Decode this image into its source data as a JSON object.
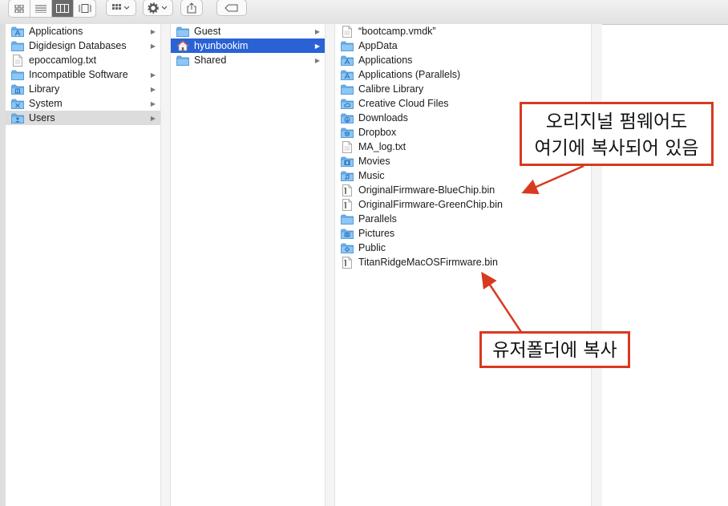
{
  "toolbar": {
    "view_buttons": [
      "icon-view",
      "list-view",
      "column-view",
      "cover-flow-view"
    ],
    "active_view": "column-view",
    "arrange_icon": "grid-arrange-icon",
    "action_icon": "gear-icon",
    "share_icon": "share-icon",
    "tag_icon": "tag-icon"
  },
  "columns": [
    {
      "items": [
        {
          "label": "Applications",
          "icon": "applications-folder-icon",
          "has_children": true
        },
        {
          "label": "Digidesign Databases",
          "icon": "folder-icon",
          "has_children": true
        },
        {
          "label": "epoccamlog.txt",
          "icon": "document-icon",
          "has_children": false
        },
        {
          "label": "Incompatible Software",
          "icon": "folder-icon",
          "has_children": true
        },
        {
          "label": "Library",
          "icon": "library-folder-icon",
          "has_children": true
        },
        {
          "label": "System",
          "icon": "system-folder-icon",
          "has_children": true
        },
        {
          "label": "Users",
          "icon": "users-folder-icon",
          "has_children": true,
          "selected": true
        }
      ]
    },
    {
      "items": [
        {
          "label": "Guest",
          "icon": "folder-icon",
          "has_children": true
        },
        {
          "label": "hyunbookim",
          "icon": "home-icon",
          "has_children": true,
          "selected": true
        },
        {
          "label": "Shared",
          "icon": "folder-icon",
          "has_children": true
        }
      ]
    },
    {
      "items": [
        {
          "label": "“bootcamp.vmdk”",
          "icon": "document-icon",
          "has_children": false
        },
        {
          "label": "AppData",
          "icon": "folder-icon",
          "has_children": true
        },
        {
          "label": "Applications",
          "icon": "applications-folder-icon",
          "has_children": true
        },
        {
          "label": "Applications (Parallels)",
          "icon": "applications-folder-icon",
          "has_children": true
        },
        {
          "label": "Calibre Library",
          "icon": "folder-icon",
          "has_children": true
        },
        {
          "label": "Creative Cloud Files",
          "icon": "creative-cloud-folder-icon",
          "has_children": true
        },
        {
          "label": "Downloads",
          "icon": "downloads-folder-icon",
          "has_children": true
        },
        {
          "label": "Dropbox",
          "icon": "dropbox-folder-icon",
          "has_children": true
        },
        {
          "label": "MA_log.txt",
          "icon": "document-icon",
          "has_children": false
        },
        {
          "label": "Movies",
          "icon": "movies-folder-icon",
          "has_children": true
        },
        {
          "label": "Music",
          "icon": "music-folder-icon",
          "has_children": true
        },
        {
          "label": "OriginalFirmware-BlueChip.bin",
          "icon": "binary-file-icon",
          "has_children": false
        },
        {
          "label": "OriginalFirmware-GreenChip.bin",
          "icon": "binary-file-icon",
          "has_children": false
        },
        {
          "label": "Parallels",
          "icon": "folder-icon",
          "has_children": true
        },
        {
          "label": "Pictures",
          "icon": "pictures-folder-icon",
          "has_children": true
        },
        {
          "label": "Public",
          "icon": "public-folder-icon",
          "has_children": true
        },
        {
          "label": "TitanRidgeMacOSFirmware.bin",
          "icon": "binary-file-icon",
          "has_children": false
        }
      ]
    }
  ],
  "annotations": {
    "original_firmware": {
      "line1": "오리지널 펌웨어도",
      "line2": "여기에 복사되어 있음"
    },
    "user_folder": {
      "text": "유저폴더에 복사"
    }
  },
  "colors": {
    "selection_blue": "#2a62d6",
    "selection_grey": "#dcdcdc",
    "folder_blue": "#6db3ee",
    "annotation_red": "#d83a1f"
  }
}
